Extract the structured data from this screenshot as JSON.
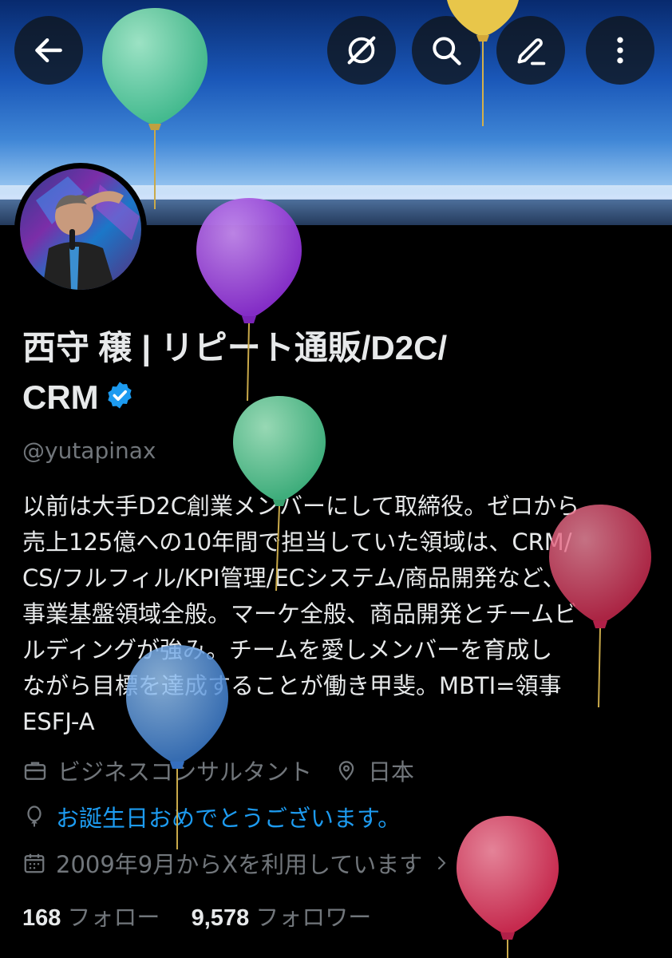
{
  "profile": {
    "name_line1": "西守 穣 | リピート通販/D2C/",
    "name_line2": "CRM",
    "handle": "@yutapinax",
    "bio": [
      "以前は大手D2C創業メンバーにして取締役。ゼロから",
      "売上125億への10年間で担当していた領域は、CRM/",
      "CS/フルフィル/KPI管理/ECシステム/商品開発など、",
      "事業基盤領域全般。マーケ全般、商品開発とチームビ",
      "ルディングが強み。チームを愛しメンバーを育成し",
      "ながら目標を達成することが働き甲斐。MBTI=領事",
      "ESFJ-A"
    ],
    "category": "ビジネスコンサルタント",
    "location": "日本",
    "birthday_message": "お誕生日おめでとうございます。",
    "joined": "2009年9月からXを利用しています",
    "following_count": "168",
    "following_label": "フォロー",
    "followers_count": "9,578",
    "followers_label": "フォロワー"
  },
  "icons": {
    "back": "arrow-left-icon",
    "grok": "slash-circle-icon",
    "search": "search-icon",
    "edit": "pencil-icon",
    "more": "more-vertical-icon",
    "verified": "verified-badge-icon",
    "category": "briefcase-icon",
    "location": "location-pin-icon",
    "birthday": "balloon-icon",
    "joined": "calendar-icon",
    "chevron": "chevron-right-icon"
  },
  "colors": {
    "background": "#000000",
    "text": "#e7e9ea",
    "secondary": "#71767b",
    "link": "#1d9bf0",
    "verified": "#1d9bf0"
  }
}
